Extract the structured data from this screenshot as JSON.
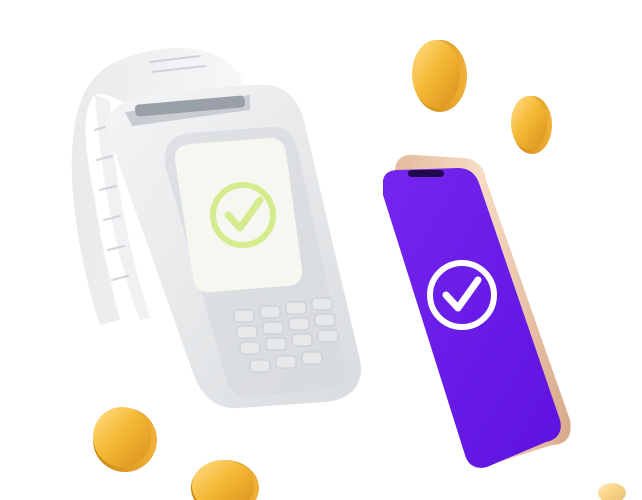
{
  "scene": {
    "background": "#ffffff",
    "terminal": {
      "icon": "check-circle-icon",
      "screen_color": "#f6f7f1",
      "check_color": "#d4ec8e",
      "body_color": "#eceef0"
    },
    "phone": {
      "icon": "check-circle-icon",
      "screen_color": "#6a1be9",
      "frame_color": "#f1cdb3",
      "check_color": "#ffffff"
    },
    "coins": {
      "icon": "coin-icon",
      "count": 5,
      "color": "#f0b42a"
    }
  }
}
